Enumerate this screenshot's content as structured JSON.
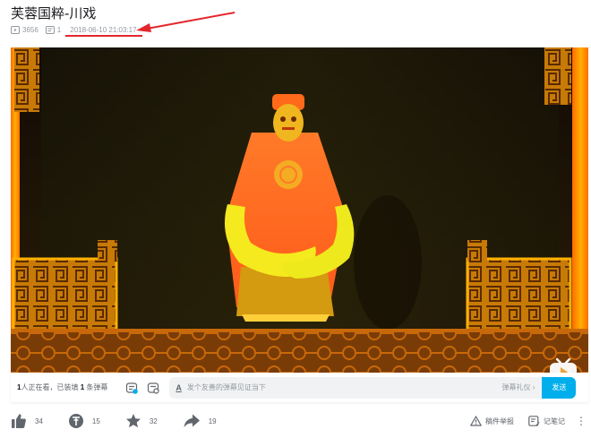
{
  "video": {
    "title": "芙蓉国粹-川戏",
    "play_count": "3656",
    "danmaku_count": "1",
    "publish_time": "2018-06-10 21:03:17"
  },
  "danmaku_bar": {
    "viewers_count": "1",
    "viewers_prefix": "人正在看，已装填 ",
    "loaded_count": "1",
    "viewers_suffix": " 条弹幕",
    "input_placeholder": "发个友善的弹幕见证当下",
    "etiquette_label": "弹幕礼仪 ›",
    "send_label": "发送"
  },
  "actions": {
    "like_count": "34",
    "coin_count": "15",
    "favorite_count": "32",
    "share_count": "19",
    "report_label": "稿件举报",
    "notes_label": "记笔记"
  },
  "icons": {
    "play": "play-count-icon",
    "danmaku": "danmaku-count-icon",
    "like": "thumbs-up-icon",
    "coin": "coin-icon",
    "favorite": "star-icon",
    "share": "share-icon",
    "report": "warning-icon",
    "notes": "note-icon",
    "more": "more-dots-icon"
  },
  "colors": {
    "accent": "#00aeec",
    "annotation": "#e3262c"
  }
}
